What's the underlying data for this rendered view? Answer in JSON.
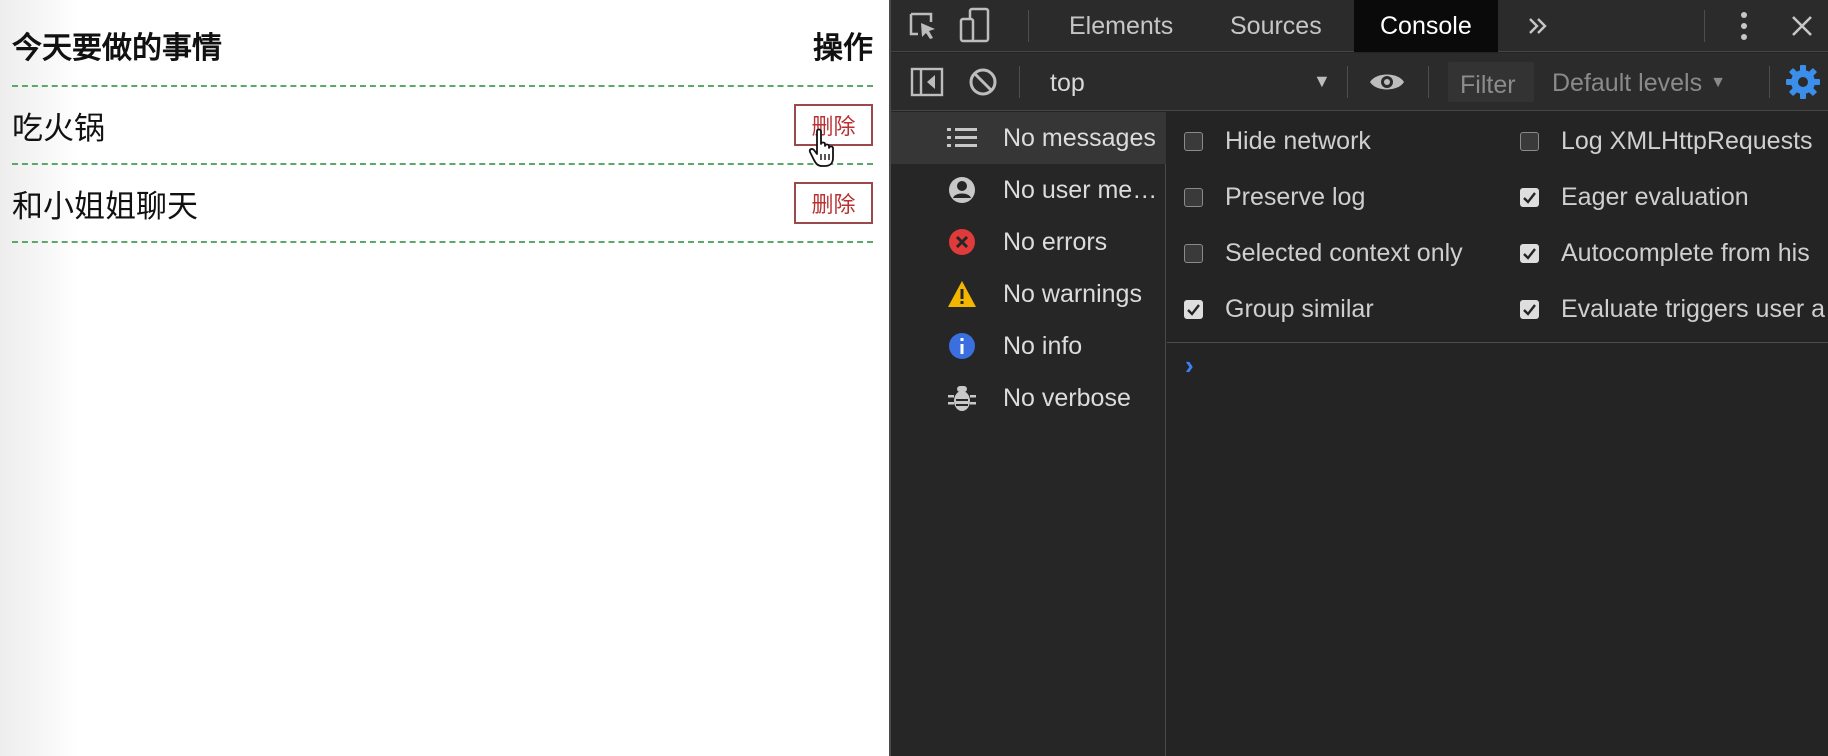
{
  "todo": {
    "header_task": "今天要做的事情",
    "header_action": "操作",
    "items": [
      {
        "text": "吃火锅",
        "button": "删除"
      },
      {
        "text": "和小姐姐聊天",
        "button": "删除"
      }
    ]
  },
  "devtools": {
    "tabs": [
      "Elements",
      "Sources",
      "Console"
    ],
    "active_tab": "Console",
    "context": "top",
    "filter_placeholder": "Filter",
    "levels": "Default levels",
    "sidebar": [
      {
        "label": "No messages",
        "icon": "list-icon"
      },
      {
        "label": "No user me…",
        "icon": "user-icon"
      },
      {
        "label": "No errors",
        "icon": "error-icon"
      },
      {
        "label": "No warnings",
        "icon": "warning-icon"
      },
      {
        "label": "No info",
        "icon": "info-icon"
      },
      {
        "label": "No verbose",
        "icon": "bug-icon"
      }
    ],
    "settings": [
      {
        "label": "Hide network",
        "checked": false
      },
      {
        "label": "Log XMLHttpRequests",
        "checked": false
      },
      {
        "label": "Preserve log",
        "checked": false
      },
      {
        "label": "Eager evaluation",
        "checked": true
      },
      {
        "label": "Selected context only",
        "checked": false
      },
      {
        "label": "Autocomplete from his",
        "checked": true
      },
      {
        "label": "Group similar",
        "checked": true
      },
      {
        "label": "Evaluate triggers user a",
        "checked": true
      }
    ],
    "prompt": "›"
  }
}
